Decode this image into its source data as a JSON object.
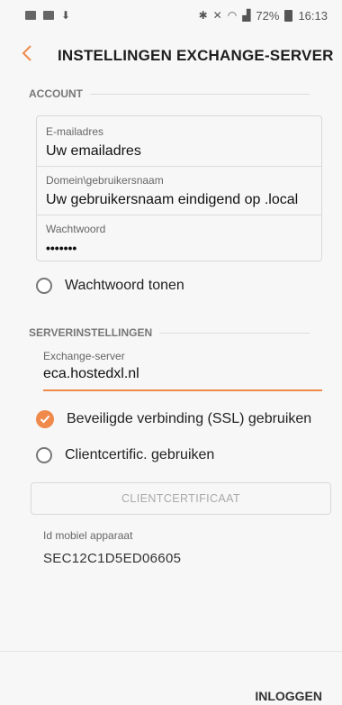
{
  "status_bar": {
    "battery_percent": "72%",
    "time": "16:13",
    "icons": [
      "gallery-icon",
      "message-icon",
      "download-icon",
      "bluetooth-icon",
      "mute-icon",
      "wifi-icon",
      "signal-icon",
      "battery-icon"
    ]
  },
  "header": {
    "title": "INSTELLINGEN EXCHANGE-SERVER"
  },
  "account": {
    "section_label": "ACCOUNT",
    "email_label": "E-mailadres",
    "email_value": "Uw emailadres",
    "domain_label": "Domein\\gebruikersnaam",
    "domain_value": "Uw gebruikersnaam eindigend op .local",
    "password_label": "Wachtwoord",
    "password_value": "•••••••",
    "show_password_label": "Wachtwoord tonen",
    "show_password_checked": false
  },
  "server": {
    "section_label": "SERVERINSTELLINGEN",
    "exchange_label": "Exchange-server",
    "exchange_value": "eca.hostedxl.nl",
    "ssl_label": "Beveiligde verbinding (SSL) gebruiken",
    "ssl_checked": true,
    "client_cert_label": "Clientcertific. gebruiken",
    "client_cert_checked": false,
    "client_cert_button": "CLIENTCERTIFICAAT",
    "device_id_label": "Id mobiel apparaat",
    "device_id_value": "SEC12C1D5ED06605"
  },
  "footer": {
    "login_label": "INLOGGEN"
  },
  "colors": {
    "accent": "#f08a4b",
    "background": "#f7f7f7"
  }
}
